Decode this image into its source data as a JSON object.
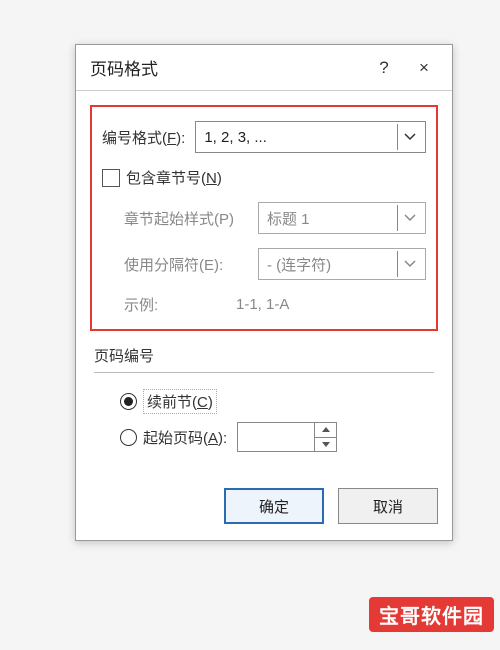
{
  "titlebar": {
    "title": "页码格式",
    "help": "?",
    "close": "×"
  },
  "format": {
    "label_pre": "编号格式(",
    "label_key": "F",
    "label_post": "):",
    "value": "1, 2, 3, ..."
  },
  "include_chapter": {
    "label_pre": "包含章节号(",
    "label_key": "N",
    "label_post": ")",
    "checked": false
  },
  "chapter_style": {
    "label": "章节起始样式(P)",
    "value": "标题 1"
  },
  "separator": {
    "label": "使用分隔符(E):",
    "value": "- (连字符)"
  },
  "example": {
    "label": "示例:",
    "value": "1-1, 1-A"
  },
  "numbering": {
    "group_label": "页码编号",
    "continue": {
      "label_pre": "续前节(",
      "label_key": "C",
      "label_post": ")",
      "selected": true
    },
    "start_at": {
      "label_pre": "起始页码(",
      "label_key": "A",
      "label_post": "):",
      "selected": false,
      "value": ""
    }
  },
  "buttons": {
    "ok": "确定",
    "cancel": "取消"
  },
  "watermark": "宝哥软件园"
}
